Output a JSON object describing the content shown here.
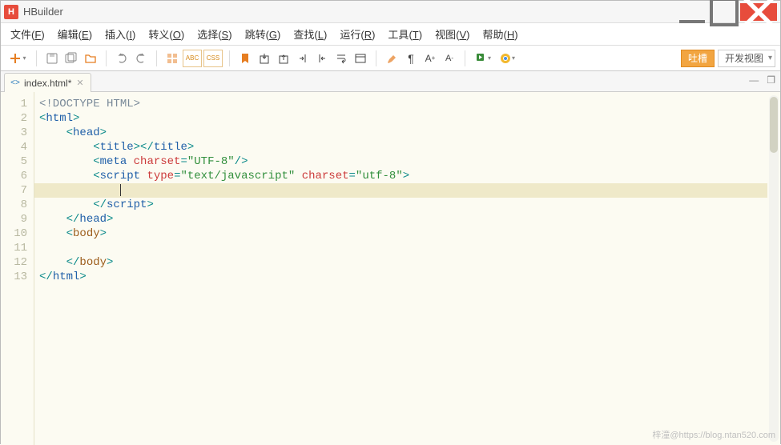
{
  "window": {
    "title": "HBuilder",
    "logo_letter": "H"
  },
  "menu": [
    {
      "label": "文件",
      "accel": "F"
    },
    {
      "label": "编辑",
      "accel": "E"
    },
    {
      "label": "插入",
      "accel": "I"
    },
    {
      "label": "转义",
      "accel": "O"
    },
    {
      "label": "选择",
      "accel": "S"
    },
    {
      "label": "跳转",
      "accel": "G"
    },
    {
      "label": "查找",
      "accel": "L"
    },
    {
      "label": "运行",
      "accel": "R"
    },
    {
      "label": "工具",
      "accel": "T"
    },
    {
      "label": "视图",
      "accel": "V"
    },
    {
      "label": "帮助",
      "accel": "H"
    }
  ],
  "tabs": [
    {
      "label": "index.html*",
      "modified": true
    }
  ],
  "toolbar_right": {
    "button1": "吐槽",
    "button2": "开发视图"
  },
  "editor": {
    "active_line": 7,
    "total_lines": 13,
    "lines": {
      "l1": "<!DOCTYPE HTML>",
      "l2_open": "<",
      "l2_tag": "html",
      "l2_close": ">",
      "l3_open": "<",
      "l3_tag": "head",
      "l3_close": ">",
      "l4_tag": "title",
      "l5_tag": "meta",
      "l5_attr": "charset",
      "l5_eq": "=",
      "l5_val": "\"UTF-8\"",
      "l5_end": "/>",
      "l6_tag": "script",
      "l6_attr1": "type",
      "l6_val1": "\"text/javascript\"",
      "l6_attr2": "charset",
      "l6_val2": "\"utf-8\"",
      "l8_tag": "script",
      "l9_tag": "head",
      "l10_tag": "body",
      "l12_tag": "body",
      "l13_tag": "html"
    }
  },
  "colors": {
    "accent": "#e74c3c",
    "editor_bg": "#FCFBF2",
    "highlight": "#efe9c9"
  },
  "watermark": "梓潼@https://blog.ntan520.com"
}
